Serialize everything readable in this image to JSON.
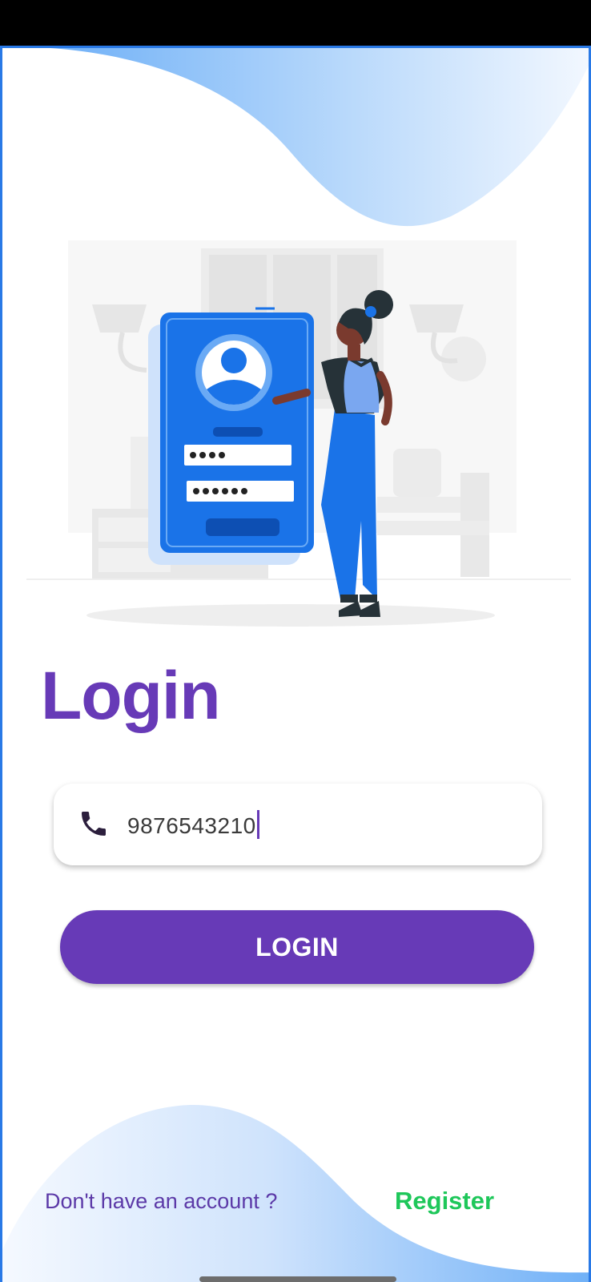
{
  "screen": {
    "title": "Login",
    "phone_field": {
      "icon": "phone-icon",
      "value": "9876543210"
    },
    "login_button_label": "LOGIN",
    "footer": {
      "prompt": "Don't have an account ?",
      "register_label": "Register"
    }
  },
  "colors": {
    "primary": "#673ab7",
    "accent_blue": "#1a73e8",
    "register_green": "#1ec75a",
    "wave_blue": "#90c2f9"
  }
}
